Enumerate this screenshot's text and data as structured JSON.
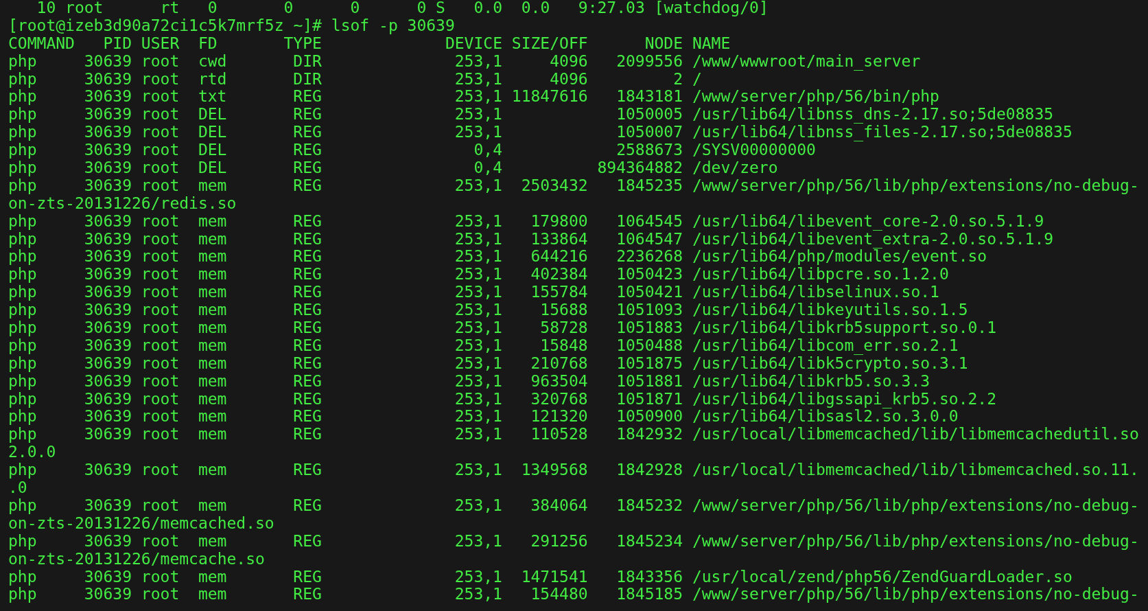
{
  "previous_line": "10 root      rt   0       0      0      0 S   0.0  0.0   9:27.03 [watchdog/0]",
  "prompt": "[root@izeb3d90a72ci1c5k7mrf5z ~]# lsof -p 30639",
  "table": {
    "columns": [
      "COMMAND",
      "PID",
      "USER",
      "FD",
      "TYPE",
      "DEVICE",
      "SIZE/OFF",
      "NODE",
      "NAME"
    ],
    "rows": [
      {
        "command": "php",
        "pid": "30639",
        "user": "root",
        "fd": "cwd",
        "type": "DIR",
        "device": "253,1",
        "size": "4096",
        "node": "2099556",
        "name": "/www/wwwroot/main_server"
      },
      {
        "command": "php",
        "pid": "30639",
        "user": "root",
        "fd": "rtd",
        "type": "DIR",
        "device": "253,1",
        "size": "4096",
        "node": "2",
        "name": "/"
      },
      {
        "command": "php",
        "pid": "30639",
        "user": "root",
        "fd": "txt",
        "type": "REG",
        "device": "253,1",
        "size": "11847616",
        "node": "1843181",
        "name": "/www/server/php/56/bin/php"
      },
      {
        "command": "php",
        "pid": "30639",
        "user": "root",
        "fd": "DEL",
        "type": "REG",
        "device": "253,1",
        "node": "1050005",
        "name": "/usr/lib64/libnss_dns-2.17.so;5de08835"
      },
      {
        "command": "php",
        "pid": "30639",
        "user": "root",
        "fd": "DEL",
        "type": "REG",
        "device": "253,1",
        "node": "1050007",
        "name": "/usr/lib64/libnss_files-2.17.so;5de08835"
      },
      {
        "command": "php",
        "pid": "30639",
        "user": "root",
        "fd": "DEL",
        "type": "REG",
        "device": "0,4",
        "node": "2588673",
        "name": "/SYSV00000000"
      },
      {
        "command": "php",
        "pid": "30639",
        "user": "root",
        "fd": "DEL",
        "type": "REG",
        "device": "0,4",
        "node": "894364882",
        "name": "/dev/zero"
      },
      {
        "command": "php",
        "pid": "30639",
        "user": "root",
        "fd": "mem",
        "type": "REG",
        "device": "253,1",
        "size": "2503432",
        "node": "1845235",
        "name": "/www/server/php/56/lib/php/extensions/no-debug-",
        "name_wrap": "on-zts-20131226/redis.so"
      },
      {
        "command": "php",
        "pid": "30639",
        "user": "root",
        "fd": "mem",
        "type": "REG",
        "device": "253,1",
        "size": "179800",
        "node": "1064545",
        "name": "/usr/lib64/libevent_core-2.0.so.5.1.9"
      },
      {
        "command": "php",
        "pid": "30639",
        "user": "root",
        "fd": "mem",
        "type": "REG",
        "device": "253,1",
        "size": "133864",
        "node": "1064547",
        "name": "/usr/lib64/libevent_extra-2.0.so.5.1.9"
      },
      {
        "command": "php",
        "pid": "30639",
        "user": "root",
        "fd": "mem",
        "type": "REG",
        "device": "253,1",
        "size": "644216",
        "node": "2236268",
        "name": "/usr/lib64/php/modules/event.so"
      },
      {
        "command": "php",
        "pid": "30639",
        "user": "root",
        "fd": "mem",
        "type": "REG",
        "device": "253,1",
        "size": "402384",
        "node": "1050423",
        "name": "/usr/lib64/libpcre.so.1.2.0"
      },
      {
        "command": "php",
        "pid": "30639",
        "user": "root",
        "fd": "mem",
        "type": "REG",
        "device": "253,1",
        "size": "155784",
        "node": "1050421",
        "name": "/usr/lib64/libselinux.so.1"
      },
      {
        "command": "php",
        "pid": "30639",
        "user": "root",
        "fd": "mem",
        "type": "REG",
        "device": "253,1",
        "size": "15688",
        "node": "1051093",
        "name": "/usr/lib64/libkeyutils.so.1.5"
      },
      {
        "command": "php",
        "pid": "30639",
        "user": "root",
        "fd": "mem",
        "type": "REG",
        "device": "253,1",
        "size": "58728",
        "node": "1051883",
        "name": "/usr/lib64/libkrb5support.so.0.1"
      },
      {
        "command": "php",
        "pid": "30639",
        "user": "root",
        "fd": "mem",
        "type": "REG",
        "device": "253,1",
        "size": "15848",
        "node": "1050488",
        "name": "/usr/lib64/libcom_err.so.2.1"
      },
      {
        "command": "php",
        "pid": "30639",
        "user": "root",
        "fd": "mem",
        "type": "REG",
        "device": "253,1",
        "size": "210768",
        "node": "1051875",
        "name": "/usr/lib64/libk5crypto.so.3.1"
      },
      {
        "command": "php",
        "pid": "30639",
        "user": "root",
        "fd": "mem",
        "type": "REG",
        "device": "253,1",
        "size": "963504",
        "node": "1051881",
        "name": "/usr/lib64/libkrb5.so.3.3"
      },
      {
        "command": "php",
        "pid": "30639",
        "user": "root",
        "fd": "mem",
        "type": "REG",
        "device": "253,1",
        "size": "320768",
        "node": "1051871",
        "name": "/usr/lib64/libgssapi_krb5.so.2.2"
      },
      {
        "command": "php",
        "pid": "30639",
        "user": "root",
        "fd": "mem",
        "type": "REG",
        "device": "253,1",
        "size": "121320",
        "node": "1050900",
        "name": "/usr/lib64/libsasl2.so.3.0.0"
      },
      {
        "command": "php",
        "pid": "30639",
        "user": "root",
        "fd": "mem",
        "type": "REG",
        "device": "253,1",
        "size": "110528",
        "node": "1842932",
        "name": "/usr/local/libmemcached/lib/libmemcachedutil.so",
        "name_wrap": "2.0.0"
      },
      {
        "command": "php",
        "pid": "30639",
        "user": "root",
        "fd": "mem",
        "type": "REG",
        "device": "253,1",
        "size": "1349568",
        "node": "1842928",
        "name": "/usr/local/libmemcached/lib/libmemcached.so.11.",
        "name_wrap": ".0"
      },
      {
        "command": "php",
        "pid": "30639",
        "user": "root",
        "fd": "mem",
        "type": "REG",
        "device": "253,1",
        "size": "384064",
        "node": "1845232",
        "name": "/www/server/php/56/lib/php/extensions/no-debug-",
        "name_wrap": "on-zts-20131226/memcached.so"
      },
      {
        "command": "php",
        "pid": "30639",
        "user": "root",
        "fd": "mem",
        "type": "REG",
        "device": "253,1",
        "size": "291256",
        "node": "1845234",
        "name": "/www/server/php/56/lib/php/extensions/no-debug-",
        "name_wrap": "on-zts-20131226/memcache.so"
      },
      {
        "command": "php",
        "pid": "30639",
        "user": "root",
        "fd": "mem",
        "type": "REG",
        "device": "253,1",
        "size": "1471541",
        "node": "1843356",
        "name": "/usr/local/zend/php56/ZendGuardLoader.so"
      },
      {
        "command": "php",
        "pid": "30639",
        "user": "root",
        "fd": "mem",
        "type": "REG",
        "device": "253,1",
        "size": "154480",
        "node": "1845185",
        "name": "/www/server/php/56/lib/php/extensions/no-debug-"
      }
    ]
  }
}
